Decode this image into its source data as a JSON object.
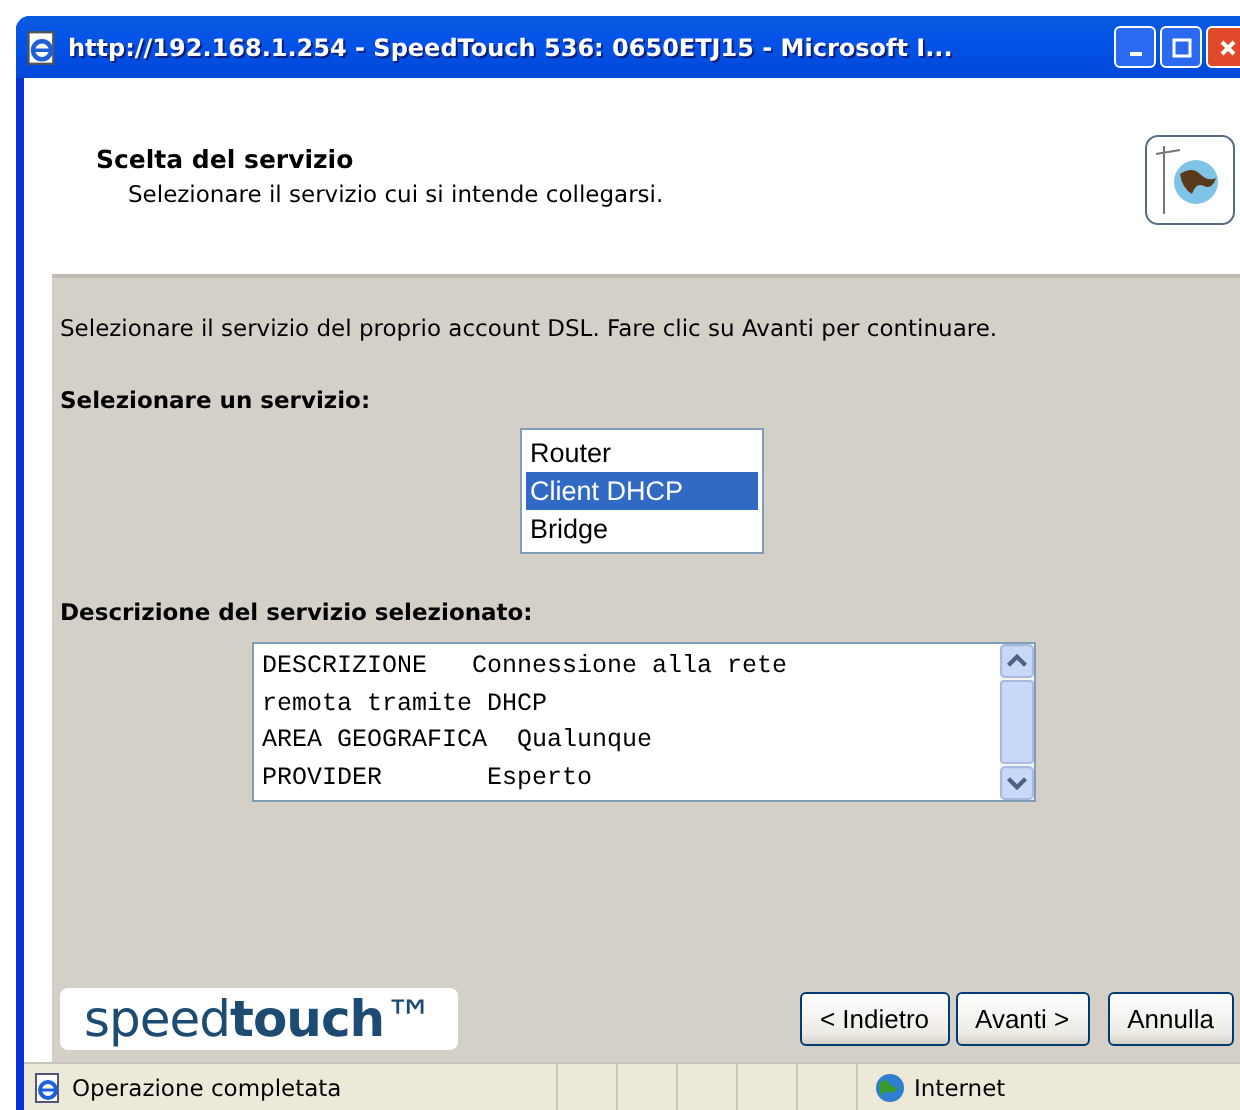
{
  "window": {
    "title": "http://192.168.1.254 - SpeedTouch 536:  0650ETJ15 - Microsoft I..."
  },
  "header": {
    "title": "Scelta del servizio",
    "subtitle": "Selezionare il servizio cui si intende collegarsi."
  },
  "intro": "Selezionare il servizio del proprio account DSL. Fare clic su Avanti per continuare.",
  "service_label": "Selezionare un servizio:",
  "services": [
    {
      "label": "Router",
      "selected": false
    },
    {
      "label": "Client DHCP",
      "selected": true
    },
    {
      "label": "Bridge",
      "selected": false
    }
  ],
  "description_label": "Descrizione del servizio selezionato:",
  "description_lines": [
    "DESCRIZIONE   Connessione alla rete",
    "remota tramite DHCP",
    "AREA GEOGRAFICA  Qualunque",
    "PROVIDER       Esperto"
  ],
  "logo": "speed**touch**™",
  "buttons": [
    "< Indietro",
    "Avanti >",
    "Annulla"
  ],
  "status_bar": {
    "message": "Operazione completata",
    "zone": "Internet"
  }
}
